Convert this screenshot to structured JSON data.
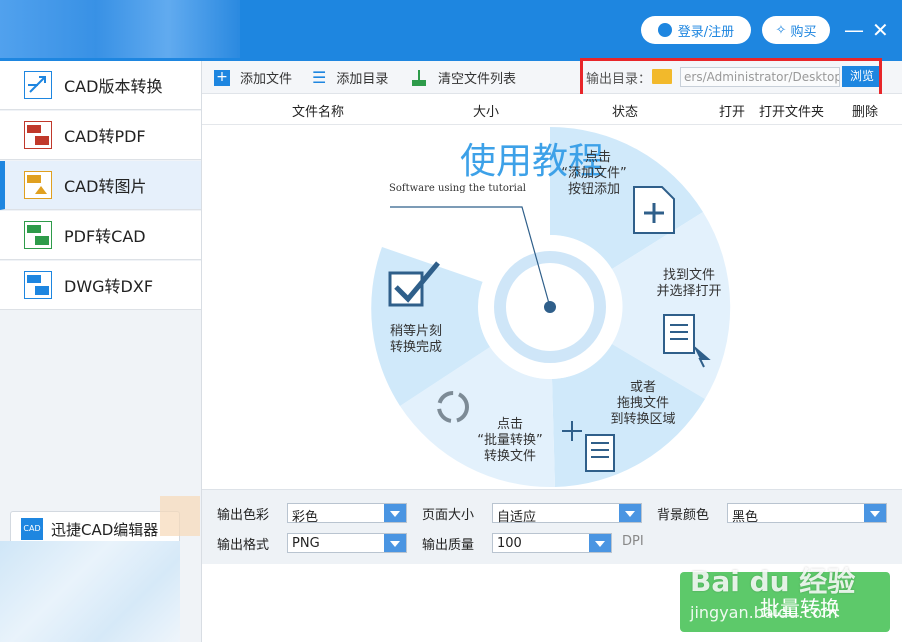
{
  "header": {
    "login_label": "登录/注册",
    "buy_label": "购买",
    "minimize": "—",
    "close": "✕"
  },
  "sidebar": {
    "items": [
      {
        "label": "CAD版本转换",
        "icon": "cad-version-icon"
      },
      {
        "label": "CAD转PDF",
        "icon": "cad-to-pdf-icon"
      },
      {
        "label": "CAD转图片",
        "icon": "cad-to-image-icon",
        "active": true
      },
      {
        "label": "PDF转CAD",
        "icon": "pdf-to-cad-icon"
      },
      {
        "label": "DWG转DXF",
        "icon": "dwg-to-dxf-icon"
      }
    ],
    "editor_label": "迅捷CAD编辑器"
  },
  "toolbar": {
    "add_file": "添加文件",
    "add_dir": "添加目录",
    "clear_list": "清空文件列表",
    "output_dir_label": "输出目录：",
    "output_dir_value": "ers/Administrator/Desktop",
    "browse": "浏览"
  },
  "table_headers": {
    "name": "文件名称",
    "size": "大小",
    "status": "状态",
    "open": "打开",
    "open_folder": "打开文件夹",
    "delete": "删除"
  },
  "tutorial": {
    "title": "使用教程",
    "subtitle": "Software using the tutorial",
    "step1": [
      "点击",
      "“添加文件”",
      "按钮添加"
    ],
    "step2": [
      "找到文件",
      "并选择打开"
    ],
    "step3": [
      "或者",
      "拖拽文件",
      "到转换区域"
    ],
    "step4": [
      "点击",
      "“批量转换”",
      "转换文件"
    ],
    "step5": [
      "稍等片刻",
      "转换完成"
    ]
  },
  "settings": {
    "color_label": "输出色彩",
    "color_value": "彩色",
    "page_size_label": "页面大小",
    "page_size_value": "自适应",
    "bg_color_label": "背景颜色",
    "bg_color_value": "黑色",
    "format_label": "输出格式",
    "format_value": "PNG",
    "quality_label": "输出质量",
    "quality_value": "100",
    "dpi": "DPI"
  },
  "convert_button": "批量转换",
  "watermark": {
    "logo": "Bai du 经验",
    "url": "jingyan.baidu.com"
  },
  "colors": {
    "accent": "#1e86e0",
    "annotation": "#e8262a",
    "convert": "#5dc96a"
  }
}
